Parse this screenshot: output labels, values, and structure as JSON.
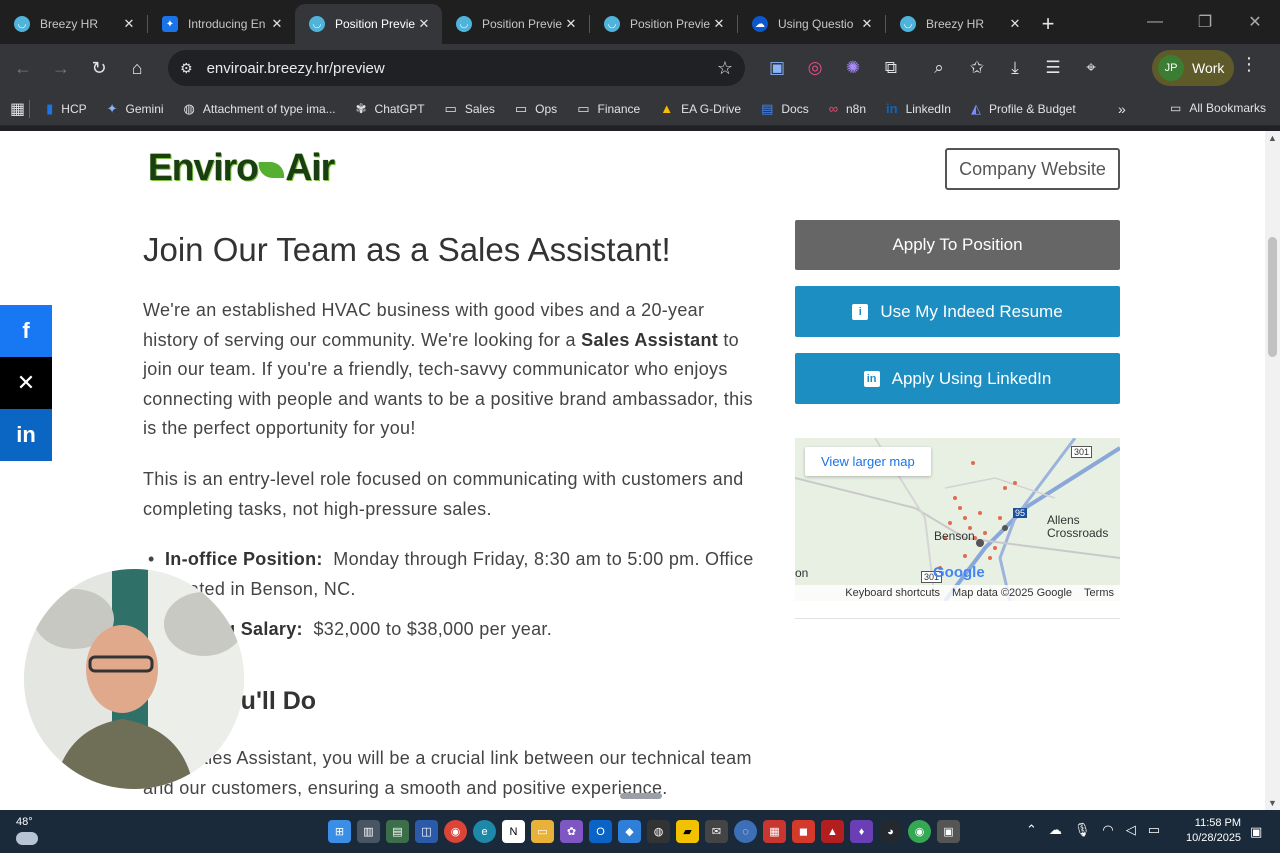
{
  "tabs": [
    {
      "title": "Breezy HR",
      "icon": "breezy-icon",
      "active": false
    },
    {
      "title": "Introducing En",
      "icon": "sparkle-icon",
      "active": false
    },
    {
      "title": "Position Previe",
      "icon": "breezy-icon",
      "active": true
    },
    {
      "title": "Position Previe",
      "icon": "breezy-icon",
      "active": false
    },
    {
      "title": "Position Previe",
      "icon": "breezy-icon",
      "active": false
    },
    {
      "title": "Using Questio",
      "icon": "cloud-icon",
      "active": false
    },
    {
      "title": "Breezy HR",
      "icon": "breezy-icon",
      "active": false
    }
  ],
  "omnibox": {
    "url": "enviroair.breezy.hr/preview"
  },
  "profile": {
    "initials": "JP",
    "label": "Work"
  },
  "bookmarks": [
    {
      "label": "HCP",
      "icon": "hcp-icon"
    },
    {
      "label": "Gemini",
      "icon": "gemini-icon"
    },
    {
      "label": "Attachment of type ima...",
      "icon": "globe-icon"
    },
    {
      "label": "ChatGPT",
      "icon": "chatgpt-icon"
    },
    {
      "label": "Sales",
      "icon": "folder-icon"
    },
    {
      "label": "Ops",
      "icon": "folder-icon"
    },
    {
      "label": "Finance",
      "icon": "folder-icon"
    },
    {
      "label": "EA G-Drive",
      "icon": "drive-icon"
    },
    {
      "label": "Docs",
      "icon": "docs-icon"
    },
    {
      "label": "n8n",
      "icon": "n8n-icon"
    },
    {
      "label": "LinkedIn",
      "icon": "linkedin-icon"
    },
    {
      "label": "Profile & Budget",
      "icon": "profile-icon"
    }
  ],
  "all_bookmarks": "All Bookmarks",
  "page": {
    "logo_text_left": "Enviro",
    "logo_text_right": "Air",
    "company_website": "Company Website",
    "title": "Join Our Team as a Sales Assistant!",
    "p1_a": "We're an established HVAC business with good vibes and a 20-year history of serving our community. We're looking for a ",
    "p1_bold": "Sales Assistant",
    "p1_b": " to join our team. If you're a friendly, tech-savvy communicator who enjoys connecting with people and wants to be a positive brand ambassador, this is the perfect opportunity for you!",
    "p2": "This is an entry-level role focused on communicating with customers and completing tasks, not high-pressure sales.",
    "bullet1_label": "In-office Position:",
    "bullet1_text": "  Monday through Friday, 8:30 am to 5:00 pm. Office located in Benson, NC.",
    "bullet2_label": "Starting Salary:",
    "bullet2_text": "  $32,000 to $38,000 per year.",
    "section_heading": "What You'll Do",
    "p3": "As a Sales Assistant, you will be a crucial link between our technical team and our customers, ensuring a smooth and positive experience.",
    "apply": "Apply To Position",
    "indeed": "Use My Indeed Resume",
    "linkedin": "Apply Using LinkedIn",
    "map": {
      "link": "View larger map",
      "town1": "Benson",
      "town2": "Allens",
      "town3": "Crossroads",
      "route1": "301",
      "route2": "95",
      "route3": "301",
      "edge_text": "on",
      "google": "Google",
      "shortcuts": "Keyboard shortcuts",
      "data": "Map data ©2025 Google",
      "terms": "Terms"
    }
  },
  "taskbar": {
    "temp": "48°",
    "time": "11:58 PM",
    "date": "10/28/2025"
  }
}
